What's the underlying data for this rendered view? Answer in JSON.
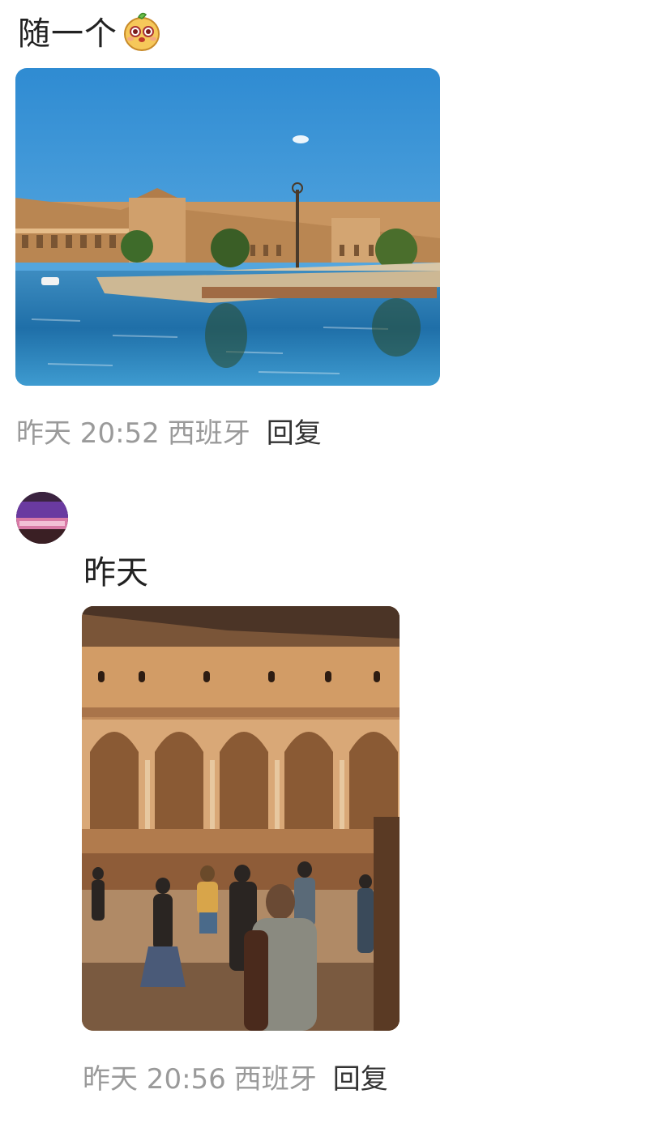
{
  "post": {
    "text": "随一个",
    "emoji": "cute-face-emoji",
    "time": "昨天 20:52",
    "location": "西班牙",
    "reply_label": "回复"
  },
  "comment": {
    "author_avatar": "avatar",
    "text": "昨天",
    "time": "昨天 20:56",
    "location": "西班牙",
    "reply_label": "回复"
  },
  "colors": {
    "text_primary": "#222222",
    "text_secondary": "#9a9a9a",
    "background": "#ffffff"
  }
}
